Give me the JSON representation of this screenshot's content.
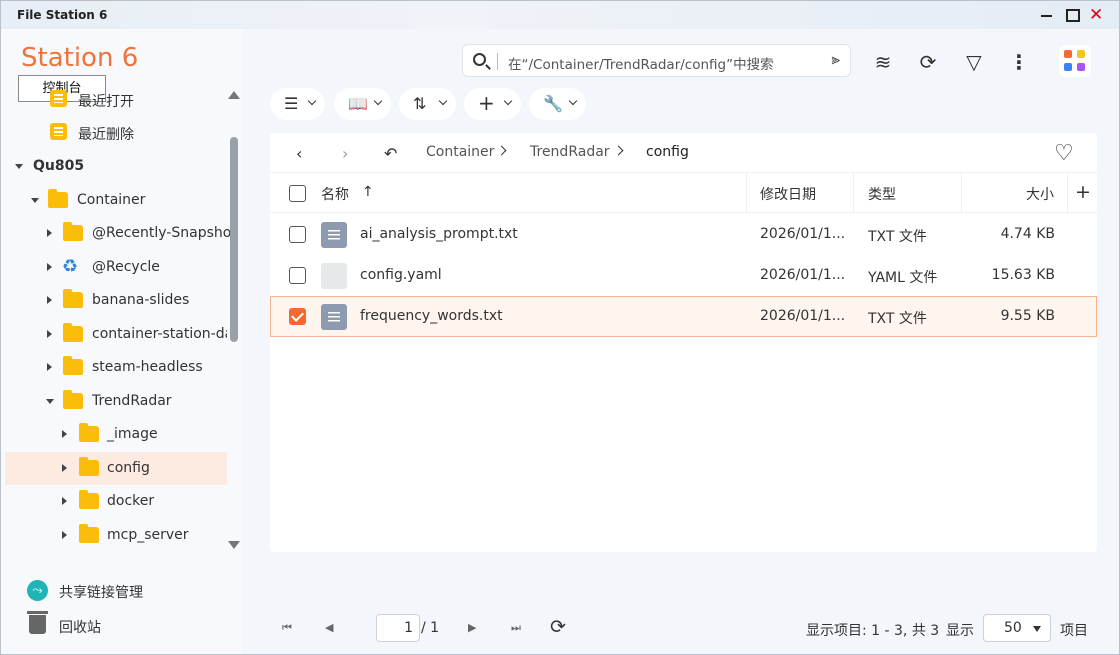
{
  "window": {
    "title": "File Station 6"
  },
  "sidebar": {
    "app_title": "Station 6",
    "console_button": "控制台",
    "quick": [
      {
        "label": "最近打开"
      },
      {
        "label": "最近删除"
      }
    ],
    "tree": [
      {
        "label": "Qu805"
      },
      {
        "label": "Container"
      },
      {
        "label": "@Recently-Snapshot"
      },
      {
        "label": "@Recycle"
      },
      {
        "label": "banana-slides"
      },
      {
        "label": "container-station-data"
      },
      {
        "label": "steam-headless"
      },
      {
        "label": "TrendRadar"
      },
      {
        "label": "_image"
      },
      {
        "label": "config"
      },
      {
        "label": "docker"
      },
      {
        "label": "mcp_server"
      }
    ],
    "bottom": [
      {
        "label": "共享链接管理"
      },
      {
        "label": "回收站"
      }
    ]
  },
  "search": {
    "placeholder": "在“/Container/TrendRadar/config”中搜索"
  },
  "breadcrumb": [
    "Container",
    "TrendRadar",
    "config"
  ],
  "table": {
    "headers": {
      "name": "名称",
      "modified": "修改日期",
      "type": "类型",
      "size": "大小"
    },
    "rows": [
      {
        "name": "ai_analysis_prompt.txt",
        "modified": "2026/01/1...",
        "type": "TXT 文件",
        "size": "4.74 KB",
        "checked": false
      },
      {
        "name": "config.yaml",
        "modified": "2026/01/1...",
        "type": "YAML 文件",
        "size": "15.63 KB",
        "checked": false
      },
      {
        "name": "frequency_words.txt",
        "modified": "2026/01/1...",
        "type": "TXT 文件",
        "size": "9.55 KB",
        "checked": true
      }
    ]
  },
  "footer": {
    "page_value": "1",
    "page_total": "/ 1",
    "items_info": "显示项目: 1 - 3, 共 3",
    "show_label": "显示",
    "page_size": "50",
    "items_label": "项目"
  },
  "colors": {
    "accent": "#f26a2e",
    "folder": "#fbbd08",
    "selected_row_border": "#f6b48f"
  }
}
